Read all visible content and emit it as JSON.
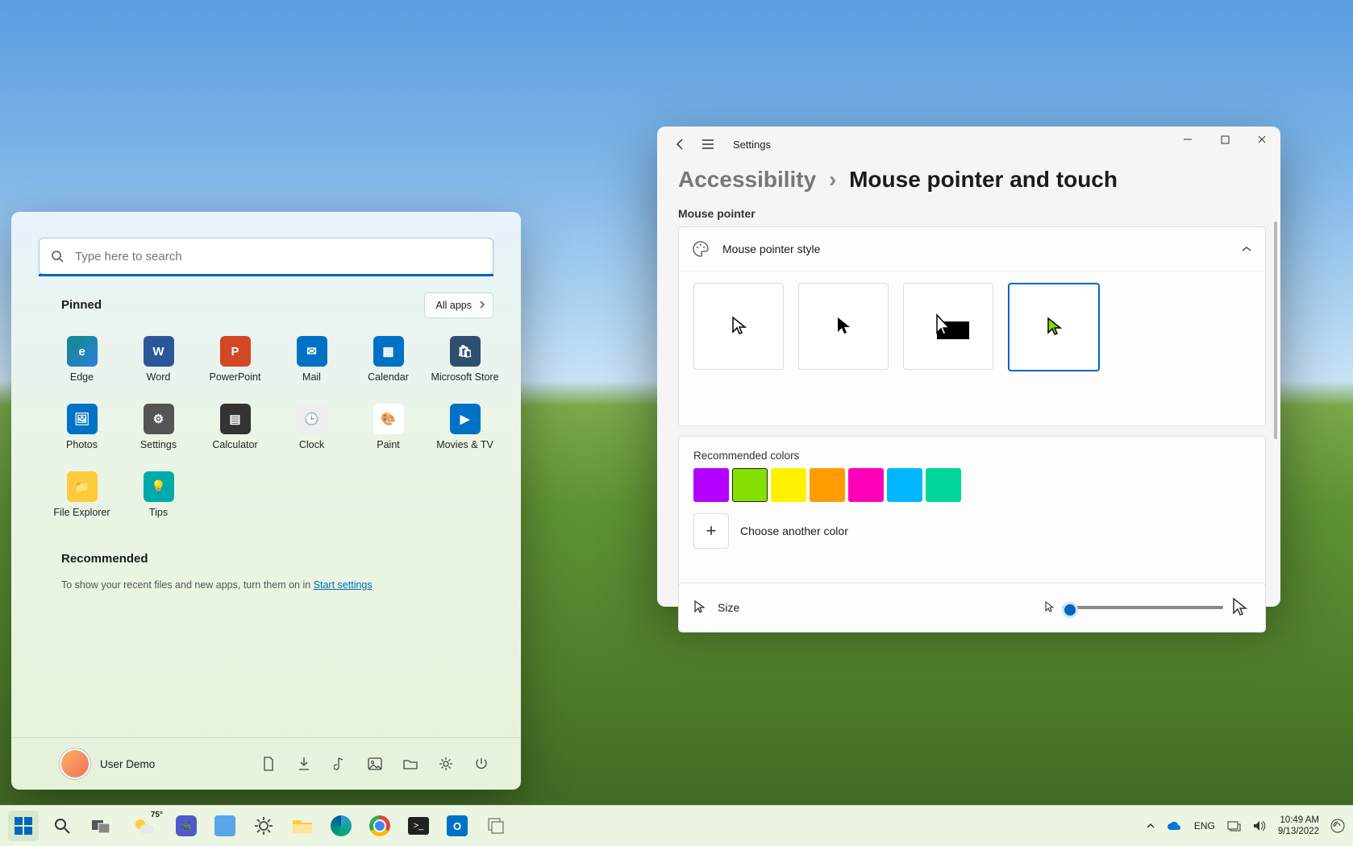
{
  "taskbar": {
    "weather_temp": "75°",
    "tray": {
      "lang": "ENG",
      "time": "10:49 AM",
      "date": "9/13/2022"
    }
  },
  "start": {
    "search_placeholder": "Type here to search",
    "pinned_label": "Pinned",
    "all_apps_label": "All apps",
    "apps": [
      {
        "label": "Edge",
        "bg": "linear-gradient(135deg,#0f8a8d,#2f7ed8)",
        "glyph": "e"
      },
      {
        "label": "Word",
        "bg": "#2b579a",
        "glyph": "W"
      },
      {
        "label": "PowerPoint",
        "bg": "#d24726",
        "glyph": "P"
      },
      {
        "label": "Mail",
        "bg": "#0072c6",
        "glyph": "✉"
      },
      {
        "label": "Calendar",
        "bg": "#0072c6",
        "glyph": "▦"
      },
      {
        "label": "Microsoft Store",
        "bg": "#2f4f6f",
        "glyph": "🛍"
      },
      {
        "label": "Photos",
        "bg": "#0072c6",
        "glyph": "🖼"
      },
      {
        "label": "Settings",
        "bg": "#555",
        "glyph": "⚙"
      },
      {
        "label": "Calculator",
        "bg": "#333",
        "glyph": "▤"
      },
      {
        "label": "Clock",
        "bg": "#eee",
        "glyph": "🕒",
        "fg": "#333"
      },
      {
        "label": "Paint",
        "bg": "#fff",
        "glyph": "🎨",
        "fg": "#333"
      },
      {
        "label": "Movies & TV",
        "bg": "#0072c6",
        "glyph": "▶"
      },
      {
        "label": "File Explorer",
        "bg": "#ffcb3d",
        "glyph": "📁",
        "fg": "#333"
      },
      {
        "label": "Tips",
        "bg": "#0aa",
        "glyph": "💡"
      }
    ],
    "recommended_label": "Recommended",
    "recommended_text": "To show your recent files and new apps, turn them on in ",
    "recommended_link": "Start settings",
    "user_name": "User Demo"
  },
  "settings": {
    "title": "Settings",
    "crumb1": "Accessibility",
    "crumb2": "Mouse pointer and touch",
    "section_label": "Mouse pointer",
    "style_label": "Mouse pointer style",
    "recommended_colors_label": "Recommended colors",
    "colors": [
      "#b400ff",
      "#84e000",
      "#fff200",
      "#ff9c00",
      "#ff00b8",
      "#00b7ff",
      "#00d699"
    ],
    "selected_color_index": 1,
    "choose_color_label": "Choose another color",
    "size_label": "Size"
  }
}
